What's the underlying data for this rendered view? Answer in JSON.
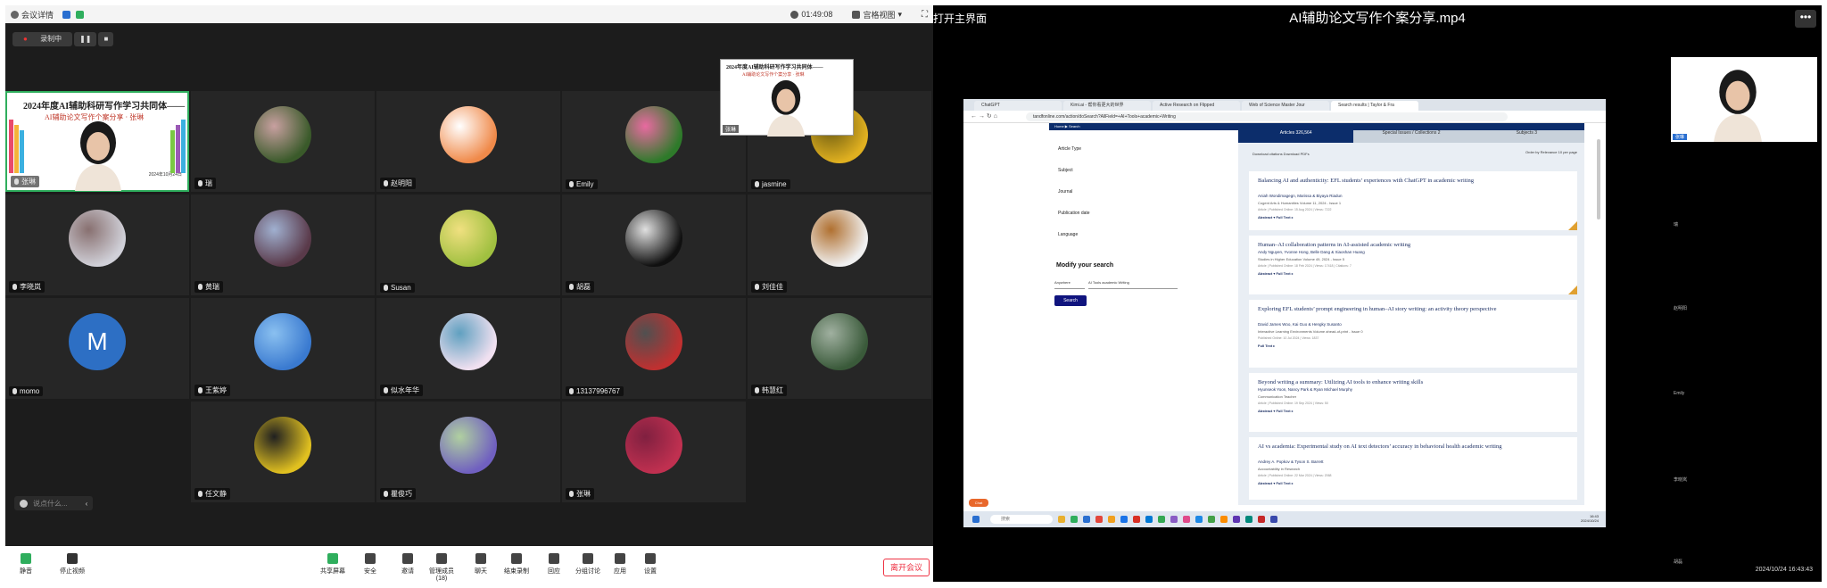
{
  "meeting": {
    "topbar": {
      "meeting_info": "会议详情",
      "timer": "01:49:08",
      "view": "宫格视图"
    },
    "rec": {
      "label": "录制中"
    },
    "speaker": {
      "name": "张琳",
      "slide_title": "2024年度AI辅助科研写作学习共同体——",
      "slide_subtitle": "AI辅助论文写作个案分享 · 张琳",
      "slide_date": "2024年10月24日"
    },
    "participants": [
      {
        "name": "瑞",
        "colors": [
          "#3a5a2a",
          "#c8a0a0"
        ]
      },
      {
        "name": "赵明阳",
        "colors": [
          "#f08a4a",
          "#ffffff"
        ]
      },
      {
        "name": "Emily",
        "colors": [
          "#2e7a2a",
          "#e86aa0"
        ]
      },
      {
        "name": "jasmine",
        "colors": [
          "#e0b020",
          "#6a5a10"
        ]
      },
      {
        "name": "李晓岚",
        "colors": [
          "#d0d0d8",
          "#887070"
        ]
      },
      {
        "name": "黄瑞",
        "colors": [
          "#5a3a4a",
          "#a0b0d0"
        ]
      },
      {
        "name": "Susan",
        "colors": [
          "#a0c040",
          "#f0e080"
        ]
      },
      {
        "name": "胡磊",
        "colors": [
          "#101010",
          "#e0e0e0"
        ]
      },
      {
        "name": "刘佳佳",
        "colors": [
          "#f0f0f0",
          "#b07030"
        ]
      },
      {
        "name": "momo",
        "letter": "M",
        "colors": [
          "#2d6fc4",
          "#2d6fc4"
        ]
      },
      {
        "name": "王紫婷",
        "colors": [
          "#3a7ad0",
          "#8ac0f0"
        ]
      },
      {
        "name": "似水年华",
        "colors": [
          "#f0e0f0",
          "#60a0c0"
        ]
      },
      {
        "name": "13137996767",
        "colors": [
          "#c03030",
          "#505050"
        ]
      },
      {
        "name": "韩慧红",
        "colors": [
          "#3a5a3a",
          "#a0b0a0"
        ]
      },
      {
        "name": "任文静",
        "colors": [
          "#e0c020",
          "#202020"
        ]
      },
      {
        "name": "瞿俊巧",
        "colors": [
          "#7060c0",
          "#b0d0a0"
        ]
      },
      {
        "name": "张琳",
        "colors": [
          "#c03050",
          "#802040"
        ]
      }
    ],
    "chat_placeholder": "说点什么...",
    "toolbar": [
      {
        "label": "静音"
      },
      {
        "label": "停止视频"
      },
      {
        "label": "共享屏幕"
      },
      {
        "label": "安全"
      },
      {
        "label": "邀请"
      },
      {
        "label": "管理成员(18)"
      },
      {
        "label": "聊天"
      },
      {
        "label": "结束录制"
      },
      {
        "label": "回应"
      },
      {
        "label": "分组讨论"
      },
      {
        "label": "应用"
      },
      {
        "label": "设置"
      }
    ],
    "leave_label": "离开会议"
  },
  "player": {
    "title": "AI辅助论文写作个案分享.mp4",
    "open_main": "打开主界面",
    "more_label": "•••",
    "datetime": "2024/10/24 16:43:43",
    "presenter_name": "张琳",
    "right_names": [
      "瑞",
      "赵明阳",
      "Emily",
      "李晓岚",
      "胡磊",
      "刘佳佳"
    ],
    "browser": {
      "tabs": [
        "ChatGPT",
        "Kimi.ai - 帮你看更大的世界",
        "Active Research on Flipped",
        "Web of Science Master Jour",
        "Search results | Taylor & Fra"
      ],
      "url": "tandfonline.com/action/doSearch?AllField=+AI+Tools+academic+Writing",
      "breadcrumb": "Home  ▶  Search",
      "filters": [
        "Article Type",
        "Subject",
        "Journal",
        "Publication date",
        "Language"
      ],
      "modify": "Modify your search",
      "field_select": "Anywhere",
      "query": "AI Tools academic Writing",
      "search_btn": "Search",
      "result_tabs": [
        "Articles 326,564",
        "Special Issues / Collections 2",
        "Subjects 3"
      ],
      "tools": "Download citations   Download PDFs",
      "sort": "Order by Relevance      10 per page",
      "results": [
        {
          "title": "Balancing AI and authenticity: EFL students’ experiences with ChatGPT in academic writing",
          "authors": "Aniah Wondimagegn, Marissa & Biyaya Riadun",
          "journal": "Cogent Arts & Humanities  Volume 11, 2024 - Issue 1",
          "meta": "Article | Published Online: 15 Aug 2024 | Views: 7222",
          "links": "Abstract ▾      Full Text ▸"
        },
        {
          "title": "Human–AI collaboration patterns in AI-assisted academic writing",
          "authors": "Andy Nguyen, Yvonne Hong, Belle Dang & Xiaoshan Huang",
          "journal": "Studies in Higher Education  Volume 49, 2024 - Issue 5",
          "meta": "Article | Published Online: 18 Feb 2024 | Views: 17418 | Citations: 7",
          "links": "Abstract ▾      Full Text ▸"
        },
        {
          "title": "Exploring EFL students’ prompt engineering in human–AI story writing: an activity theory perspective",
          "authors": "David James Woo, Kai Guo & Hengky Susanto",
          "journal": "Interactive Learning Environments  Volume ahead-of-print - Issue 0",
          "meta": "Published Online: 10 Jul 2024 | Views: 1837",
          "links": "Full Text ▸"
        },
        {
          "title": "Beyond writing a summary: Utilizing AI tools to enhance writing skills",
          "authors": "Hyunseok Yoon, Nancy Park & Ryan Michael Murphy",
          "journal": "Communication Teacher",
          "meta": "Article | Published Online: 19 Sep 2024 | Views: 50",
          "links": "Abstract ▾      Full Text ▸"
        },
        {
          "title": "AI vs academia: Experimental study on AI text detectors’ accuracy in behavioral health academic writing",
          "authors": "Andrey A. Popkov & Tyson S. Barrett",
          "journal": "Accountability in Research",
          "meta": "Article | Published Online: 22 Mar 2024 | Views: 2068",
          "links": "Abstract ▾      Full Text ▸"
        }
      ],
      "taskbar_search": "搜索",
      "taskbar_time": "16:43",
      "taskbar_date": "2024/10/24",
      "chat_tab": "Chat"
    }
  }
}
